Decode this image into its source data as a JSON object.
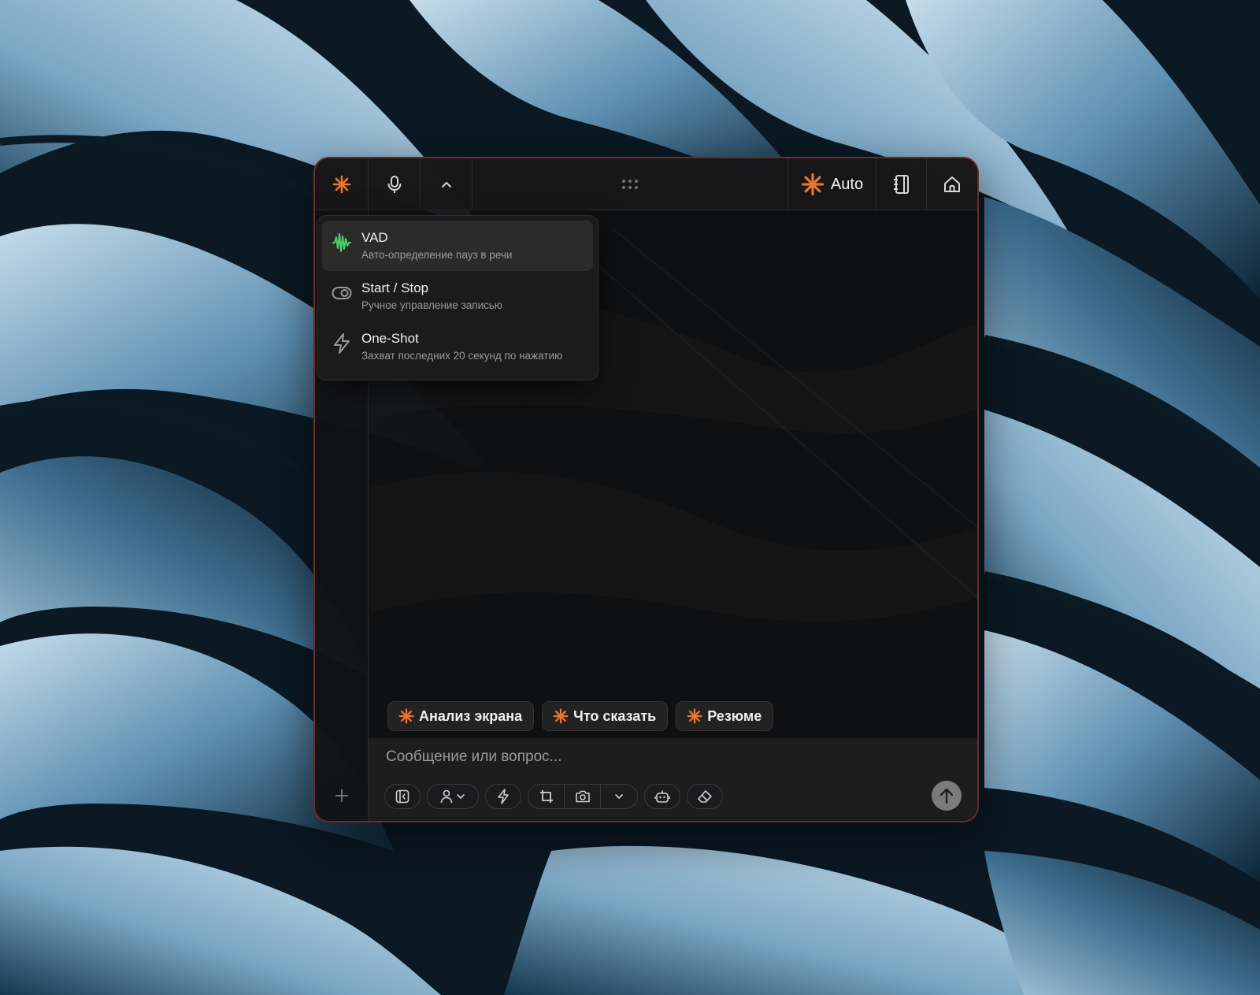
{
  "app": {
    "model_label": "Auto",
    "accent_color": "#e8762f",
    "vad_color": "#4cd06a"
  },
  "topbar": {
    "icons": [
      "asterisk-logo-icon",
      "microphone-icon",
      "chevron-up-icon",
      "drag-handle-icon",
      "asterisk-icon",
      "notebook-icon",
      "home-icon"
    ]
  },
  "record_menu": {
    "items": [
      {
        "title": "VAD",
        "subtitle": "Авто-определение пауз в речи",
        "icon": "waveform-icon",
        "selected": true
      },
      {
        "title": "Start / Stop",
        "subtitle": "Ручное управление записью",
        "icon": "toggle-icon"
      },
      {
        "title": "One-Shot",
        "subtitle": "Захват последних 20 секунд по нажатию",
        "icon": "lightning-icon"
      }
    ]
  },
  "quick_actions": [
    {
      "label": "Анализ экрана"
    },
    {
      "label": "Что сказать"
    },
    {
      "label": "Резюме"
    }
  ],
  "composer": {
    "placeholder": "Сообщение или вопрос...",
    "value": ""
  },
  "toolbar": {
    "icons": [
      "panel-collapse-icon",
      "user-icon",
      "chevron-down-icon",
      "lightning-icon",
      "crop-icon",
      "camera-icon",
      "chevron-down-icon",
      "robot-icon",
      "eraser-icon",
      "arrow-up-icon"
    ]
  }
}
